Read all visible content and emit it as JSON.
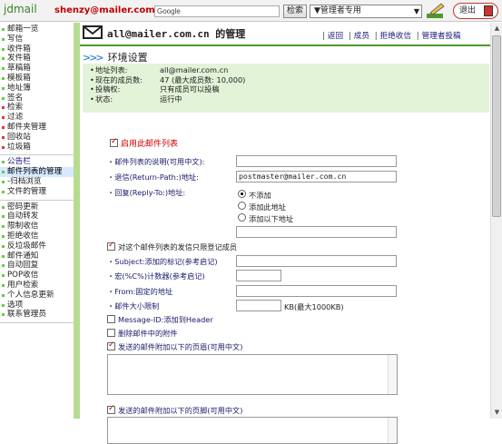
{
  "topbar": {
    "logo": "jdmail",
    "user_email": "shenzy@mailer.com.cn",
    "search_placeholder": "Google",
    "search_button": "检索",
    "mode_select": "▼管理者专用",
    "logout": "退出"
  },
  "sidebar": {
    "groups": [
      [
        "邮箱一览",
        "写信",
        "收件箱",
        "发件箱",
        "草稿箱",
        "模板箱",
        "地址簿",
        "签名",
        "检索",
        "过滤",
        "邮件夹管理",
        "回收站",
        "垃圾箱"
      ],
      [
        "公告栏",
        "邮件列表的管理",
        "-归档浏览",
        "文件的管理"
      ],
      [
        "密码更新",
        "自动转发",
        "限制收信",
        "拒绝收信",
        "反垃圾邮件",
        "邮件通知",
        "自动回复",
        "POP收信",
        "用户检索",
        "个人信息更新",
        "选项",
        "联系管理员"
      ]
    ]
  },
  "header": {
    "title": "all@mailer.com.cn 的管理",
    "links": [
      "返回",
      "成员",
      "拒绝收信",
      "管理者投稿"
    ]
  },
  "section": {
    "title": "环境设置",
    "info": [
      {
        "k": "地址列表:",
        "v": "all@mailer.com.cn"
      },
      {
        "k": "现在的成员数:",
        "v": "47 (最大成员数: 10,000)"
      },
      {
        "k": "投稿权:",
        "v": "只有成员可以投稿"
      },
      {
        "k": "状态:",
        "v": "运行中"
      }
    ]
  },
  "form": {
    "enable_list": "启用此邮件列表",
    "description_label": "・邮件列表的说明(可用中文):",
    "description_value": "",
    "return_path_label": "・退信(Return-Path:)地址:",
    "return_path_value": "postmaster@mailer.com.cn",
    "reply_to_label": "・回复(Reply-To:)地址:",
    "reply_to_options": [
      "不添加",
      "添加此地址",
      "添加以下地址"
    ],
    "reply_to_value": "",
    "restrict_members": "对这个邮件列表的发信只限登记成员",
    "subject_tag_label": "・Subject:添加的标记(参考启记)",
    "subject_tag_value": "",
    "counter_label": "・宏(%C%)计数器(参考启记)",
    "counter_value": "",
    "from_label": "・From:固定的地址",
    "from_value": "",
    "size_limit_label": "・邮件大小限制",
    "size_limit_value": "",
    "size_limit_unit": "KB(最大1000KB)",
    "add_message_id": "Message-ID:添加到Header",
    "remove_attachments": "删除邮件中的附件",
    "header_text_label": "发送的邮件附加以下的页眉(可用中文)",
    "footer_text_label": "发送的邮件附加以下的页脚(可用中文)"
  }
}
